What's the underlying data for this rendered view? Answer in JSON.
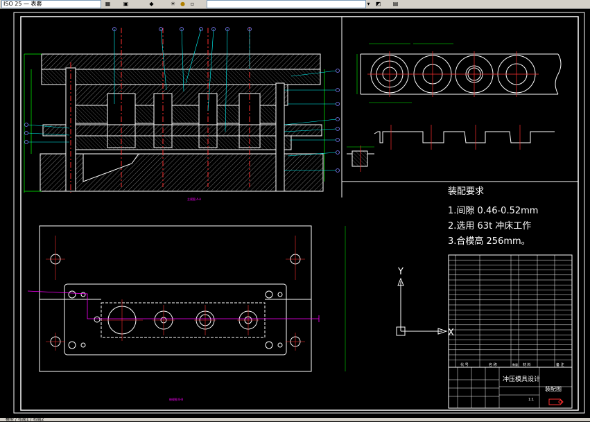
{
  "toolbar": {
    "layer_combo": "ISO 25 — 表套",
    "style_combo": "",
    "icons": [
      "layer-manager-icon",
      "layer-state-icon",
      "layers-icon",
      "sun-icon",
      "bulb-icon",
      "lock-icon",
      "color-swatch-icon",
      "properties-icon",
      "match-icon"
    ]
  },
  "drawing": {
    "tech_req_title": "装配要求",
    "tech_req_1": "1.间隙 0.46-0.52mm",
    "tech_req_2": "2.选用 63t 冲床工作",
    "tech_req_3": "3.合模高 256mm。",
    "ucs_y": "Y",
    "ucs_x": "X",
    "section_label_front": "主视图 A-A",
    "section_label_plan": "俯视图 B-B",
    "title_block": {
      "name": "冲压模具设计",
      "drawing_type": "装配图",
      "header_code": "代 号",
      "header_name": "名 称",
      "header_qty": "数量",
      "header_material": "材 料",
      "header_remark": "备 注",
      "scale": "1:1"
    }
  },
  "colors": {
    "outline": "#ffffff",
    "centerline": "#ff3030",
    "dimension": "#00ff00",
    "leader": "#00ffff",
    "balloon": "#6060ff",
    "magenta": "#ff00ff",
    "hatch": "#c0c0c0"
  },
  "status": {
    "tab": "模型 / 布局1 / 布局2"
  }
}
